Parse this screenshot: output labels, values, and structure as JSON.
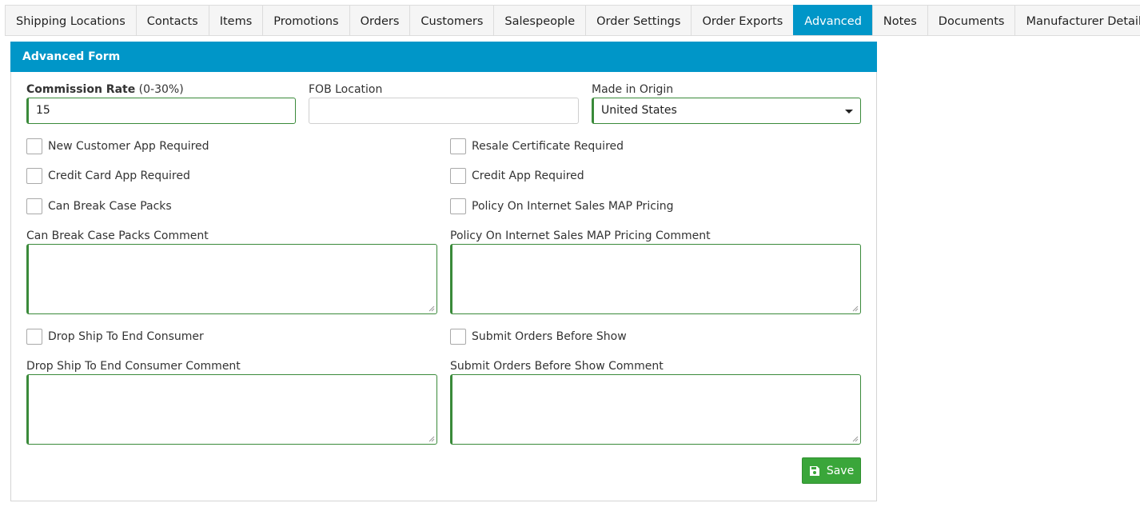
{
  "tabs": [
    {
      "label": "Shipping Locations"
    },
    {
      "label": "Contacts"
    },
    {
      "label": "Items"
    },
    {
      "label": "Promotions"
    },
    {
      "label": "Orders"
    },
    {
      "label": "Customers"
    },
    {
      "label": "Salespeople"
    },
    {
      "label": "Order Settings"
    },
    {
      "label": "Order Exports"
    },
    {
      "label": "Advanced"
    },
    {
      "label": "Notes"
    },
    {
      "label": "Documents"
    },
    {
      "label": "Manufacturer Detail"
    }
  ],
  "active_tab": "Advanced",
  "panel": {
    "title": "Advanced Form"
  },
  "form": {
    "commission_rate": {
      "label": "Commission Rate",
      "hint": "(0-30%)",
      "value": "15"
    },
    "fob_location": {
      "label": "FOB Location",
      "value": ""
    },
    "made_in_origin": {
      "label": "Made in Origin",
      "value": "United States"
    },
    "checkboxes": {
      "new_customer_app": {
        "label": "New Customer App Required",
        "checked": false
      },
      "resale_certificate": {
        "label": "Resale Certificate Required",
        "checked": false
      },
      "credit_card_app": {
        "label": "Credit Card App Required",
        "checked": false
      },
      "credit_app": {
        "label": "Credit App Required",
        "checked": false
      },
      "break_case_packs": {
        "label": "Can Break Case Packs",
        "checked": false
      },
      "internet_map_pricing": {
        "label": "Policy On Internet Sales MAP Pricing",
        "checked": false
      },
      "drop_ship": {
        "label": "Drop Ship To End Consumer",
        "checked": false
      },
      "submit_before_show": {
        "label": "Submit Orders Before Show",
        "checked": false
      }
    },
    "comments": {
      "break_case_packs": {
        "label": "Can Break Case Packs Comment",
        "value": ""
      },
      "internet_map_pricing": {
        "label": "Policy On Internet Sales MAP Pricing Comment",
        "value": ""
      },
      "drop_ship": {
        "label": "Drop Ship To End Consumer Comment",
        "value": ""
      },
      "submit_before_show": {
        "label": "Submit Orders Before Show Comment",
        "value": ""
      }
    },
    "save_label": "Save"
  },
  "colors": {
    "accent": "#0096c8",
    "save": "#3aa63a",
    "field_border": "#3a8a3a"
  },
  "icons": {
    "save": "floppy-disk-icon",
    "dropdown": "caret-down-icon",
    "resize": "resize-grip-icon"
  }
}
